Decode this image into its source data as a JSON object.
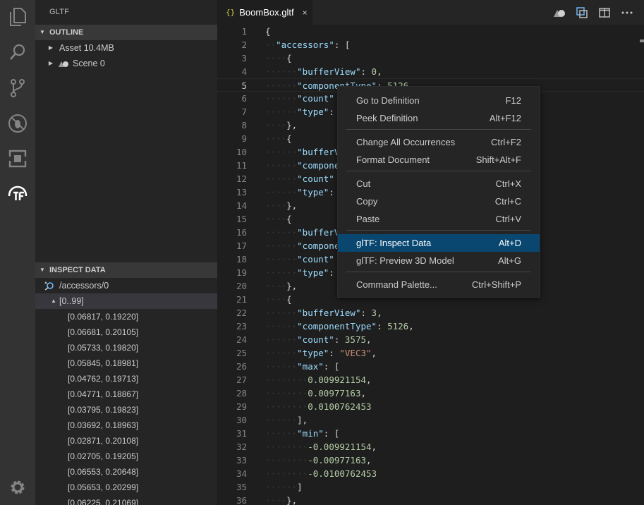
{
  "sidebar": {
    "title": "GLTF",
    "outline": {
      "header": "OUTLINE",
      "items": [
        {
          "label": "Asset 10.4MB"
        },
        {
          "label": "Scene 0"
        }
      ]
    },
    "inspect": {
      "header": "INSPECT DATA",
      "path": "/accessors/0",
      "group": "[0..99]",
      "rows": [
        "[0.06817, 0.19220]",
        "[0.06681, 0.20105]",
        "[0.05733, 0.19820]",
        "[0.05845, 0.18981]",
        "[0.04762, 0.19713]",
        "[0.04771, 0.18867]",
        "[0.03795, 0.19823]",
        "[0.03692, 0.18963]",
        "[0.02871, 0.20108]",
        "[0.02705, 0.19205]",
        "[0.06553, 0.20648]",
        "[0.05653, 0.20299]",
        "[0.06225, 0.21069]"
      ]
    }
  },
  "editor": {
    "tab": {
      "braces": "{}",
      "filename": "BoomBox.gltf",
      "close": "×"
    },
    "lines": [
      {
        "n": "1",
        "ws": "",
        "parts": [
          [
            "p",
            "{"
          ]
        ]
      },
      {
        "n": "2",
        "ws": "··",
        "parts": [
          [
            "k",
            "\"accessors\""
          ],
          [
            "p",
            ": ["
          ]
        ]
      },
      {
        "n": "3",
        "ws": "····",
        "parts": [
          [
            "p",
            "{"
          ]
        ]
      },
      {
        "n": "4",
        "ws": "······",
        "parts": [
          [
            "k",
            "\"bufferView\""
          ],
          [
            "p",
            ": "
          ],
          [
            "n",
            "0"
          ],
          [
            "p",
            ","
          ]
        ]
      },
      {
        "n": "5",
        "ws": "······",
        "parts": [
          [
            "k",
            "\"componentType\""
          ],
          [
            "p",
            ": "
          ],
          [
            "n",
            "5126"
          ],
          [
            "p",
            ","
          ]
        ]
      },
      {
        "n": "6",
        "ws": "······",
        "parts": [
          [
            "k",
            "\"count\""
          ]
        ]
      },
      {
        "n": "7",
        "ws": "······",
        "parts": [
          [
            "k",
            "\"type\""
          ],
          [
            "p",
            ":"
          ]
        ]
      },
      {
        "n": "8",
        "ws": "····",
        "parts": [
          [
            "p",
            "},"
          ]
        ]
      },
      {
        "n": "9",
        "ws": "····",
        "parts": [
          [
            "p",
            "{"
          ]
        ]
      },
      {
        "n": "10",
        "ws": "······",
        "parts": [
          [
            "k",
            "\"bufferV"
          ]
        ]
      },
      {
        "n": "11",
        "ws": "······",
        "parts": [
          [
            "k",
            "\"compone"
          ]
        ]
      },
      {
        "n": "12",
        "ws": "······",
        "parts": [
          [
            "k",
            "\"count\""
          ]
        ]
      },
      {
        "n": "13",
        "ws": "······",
        "parts": [
          [
            "k",
            "\"type\""
          ],
          [
            "p",
            ":"
          ]
        ]
      },
      {
        "n": "14",
        "ws": "····",
        "parts": [
          [
            "p",
            "},"
          ]
        ]
      },
      {
        "n": "15",
        "ws": "····",
        "parts": [
          [
            "p",
            "{"
          ]
        ]
      },
      {
        "n": "16",
        "ws": "······",
        "parts": [
          [
            "k",
            "\"bufferV"
          ]
        ]
      },
      {
        "n": "17",
        "ws": "······",
        "parts": [
          [
            "k",
            "\"compone"
          ]
        ]
      },
      {
        "n": "18",
        "ws": "······",
        "parts": [
          [
            "k",
            "\"count\""
          ]
        ]
      },
      {
        "n": "19",
        "ws": "······",
        "parts": [
          [
            "k",
            "\"type\""
          ],
          [
            "p",
            ":"
          ]
        ]
      },
      {
        "n": "20",
        "ws": "····",
        "parts": [
          [
            "p",
            "},"
          ]
        ]
      },
      {
        "n": "21",
        "ws": "····",
        "parts": [
          [
            "p",
            "{"
          ]
        ]
      },
      {
        "n": "22",
        "ws": "······",
        "parts": [
          [
            "k",
            "\"bufferView\""
          ],
          [
            "p",
            ": "
          ],
          [
            "n",
            "3"
          ],
          [
            "p",
            ","
          ]
        ]
      },
      {
        "n": "23",
        "ws": "······",
        "parts": [
          [
            "k",
            "\"componentType\""
          ],
          [
            "p",
            ": "
          ],
          [
            "n",
            "5126"
          ],
          [
            "p",
            ","
          ]
        ]
      },
      {
        "n": "24",
        "ws": "······",
        "parts": [
          [
            "k",
            "\"count\""
          ],
          [
            "p",
            ": "
          ],
          [
            "n",
            "3575"
          ],
          [
            "p",
            ","
          ]
        ]
      },
      {
        "n": "25",
        "ws": "······",
        "parts": [
          [
            "k",
            "\"type\""
          ],
          [
            "p",
            ": "
          ],
          [
            "s",
            "\"VEC3\""
          ],
          [
            "p",
            ","
          ]
        ]
      },
      {
        "n": "26",
        "ws": "······",
        "parts": [
          [
            "k",
            "\"max\""
          ],
          [
            "p",
            ": ["
          ]
        ]
      },
      {
        "n": "27",
        "ws": "········",
        "parts": [
          [
            "n",
            "0.009921154"
          ],
          [
            "p",
            ","
          ]
        ]
      },
      {
        "n": "28",
        "ws": "········",
        "parts": [
          [
            "n",
            "0.00977163"
          ],
          [
            "p",
            ","
          ]
        ]
      },
      {
        "n": "29",
        "ws": "········",
        "parts": [
          [
            "n",
            "0.0100762453"
          ]
        ]
      },
      {
        "n": "30",
        "ws": "······",
        "parts": [
          [
            "p",
            "],"
          ]
        ]
      },
      {
        "n": "31",
        "ws": "······",
        "parts": [
          [
            "k",
            "\"min\""
          ],
          [
            "p",
            ": ["
          ]
        ]
      },
      {
        "n": "32",
        "ws": "········",
        "parts": [
          [
            "n",
            "-0.009921154"
          ],
          [
            "p",
            ","
          ]
        ]
      },
      {
        "n": "33",
        "ws": "········",
        "parts": [
          [
            "n",
            "-0.00977163"
          ],
          [
            "p",
            ","
          ]
        ]
      },
      {
        "n": "34",
        "ws": "········",
        "parts": [
          [
            "n",
            "-0.0100762453"
          ]
        ]
      },
      {
        "n": "35",
        "ws": "······",
        "parts": [
          [
            "p",
            "]"
          ]
        ]
      },
      {
        "n": "36",
        "ws": "····",
        "parts": [
          [
            "p",
            "},"
          ]
        ]
      }
    ],
    "current_line": "5"
  },
  "context_menu": {
    "items": [
      {
        "label": "Go to Definition",
        "key": "F12"
      },
      {
        "label": "Peek Definition",
        "key": "Alt+F12"
      },
      {
        "label": "Change All Occurrences",
        "key": "Ctrl+F2"
      },
      {
        "label": "Format Document",
        "key": "Shift+Alt+F"
      },
      {
        "label": "Cut",
        "key": "Ctrl+X"
      },
      {
        "label": "Copy",
        "key": "Ctrl+C"
      },
      {
        "label": "Paste",
        "key": "Ctrl+V"
      },
      {
        "label": "glTF: Inspect Data",
        "key": "Alt+D"
      },
      {
        "label": "glTF: Preview 3D Model",
        "key": "Alt+G"
      },
      {
        "label": "Command Palette...",
        "key": "Ctrl+Shift+P"
      }
    ],
    "active_item": "glTF: Inspect Data"
  },
  "colors": {
    "accent": "#094771",
    "activity_bar": "#333333",
    "sidebar": "#252526",
    "editor": "#1e1e1e"
  },
  "icons": [
    "explorer-icon",
    "search-icon",
    "source-control-icon",
    "debug-icon",
    "extensions-icon",
    "gltf-icon",
    "settings-gear-icon",
    "chevron-right-icon",
    "chevron-down-icon",
    "json-file-icon",
    "close-icon",
    "preview-3d-icon",
    "open-changes-icon",
    "split-editor-icon",
    "more-actions-icon"
  ]
}
